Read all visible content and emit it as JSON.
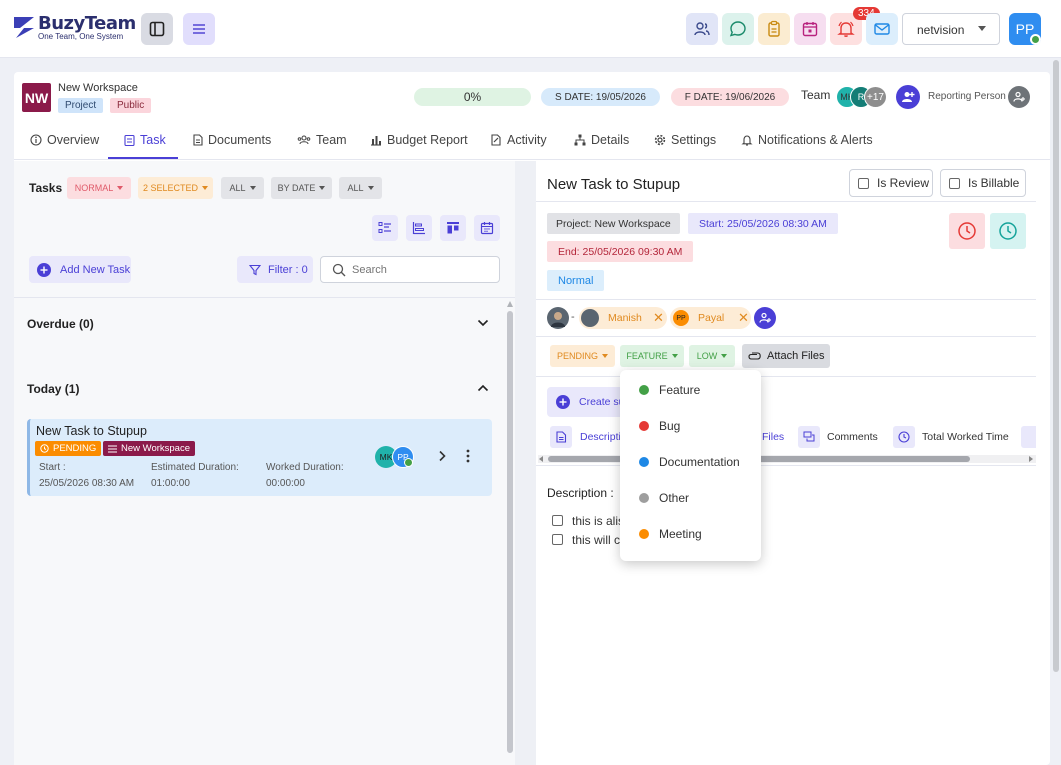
{
  "app": {
    "title": "BuzyTeam",
    "subtitle": "One Team, One System",
    "notifications_count": "334",
    "workspace_select": "netvision",
    "user_initials": "PP"
  },
  "workspace": {
    "initials": "NW",
    "name": "New Workspace",
    "tag_project": "Project",
    "tag_public": "Public",
    "progress": "0%",
    "progress_value": 0,
    "start_date": "S DATE: 19/05/2026",
    "finish_date": "F DATE: 19/06/2026",
    "team_label": "Team",
    "team_avatars": [
      "MK",
      "R",
      "+17"
    ],
    "reporting_label": "Reporting Person"
  },
  "tabs": [
    "Overview",
    "Task",
    "Documents",
    "Team",
    "Budget Report",
    "Activity",
    "Details",
    "Settings",
    "Notifications & Alerts"
  ],
  "task_list": {
    "heading": "Tasks",
    "filters": [
      "NORMAL",
      "2 SELECTED",
      "ALL",
      "BY DATE",
      "ALL"
    ],
    "add_label": "Add New Task",
    "filter_label": "Filter : 0",
    "search_placeholder": "Search",
    "groups": [
      {
        "title": "Overdue (0)"
      },
      {
        "title": "Today (1)"
      }
    ],
    "card": {
      "title": "New Task to Stupup",
      "status": "PENDING",
      "workspace": "New Workspace",
      "start_label": "Start :",
      "start_value": "25/05/2026 08:30 AM",
      "est_label": "Estimated Duration:",
      "est_value": "01:00:00",
      "worked_label": "Worked Duration:",
      "worked_value": "00:00:00",
      "avatars": [
        "MK",
        "PP"
      ]
    }
  },
  "detail": {
    "title": "New Task to Stupup",
    "is_review": "Is Review",
    "is_billable": "Is Billable",
    "project": "Project: New Workspace",
    "start": "Start: 25/05/2026 08:30 AM",
    "end": "End: 25/05/2026 09:30 AM",
    "priority": "Normal",
    "assignees": [
      "Manish",
      "Payal"
    ],
    "status_chip": "PENDING",
    "type_chip": "FEATURE",
    "level_chip": "LOW",
    "attach_label": "Attach Files",
    "create_sub_label": "Create su",
    "subtabs": [
      "Descripti",
      "Files",
      "Comments",
      "Total Worked Time"
    ],
    "description_label": "Description :",
    "checklist": [
      "this is alis",
      "this will c"
    ]
  },
  "type_menu": {
    "items": [
      {
        "label": "Feature",
        "color": "#43a047"
      },
      {
        "label": "Bug",
        "color": "#e53935"
      },
      {
        "label": "Documentation",
        "color": "#1e88e5"
      },
      {
        "label": "Other",
        "color": "#9e9e9e"
      },
      {
        "label": "Meeting",
        "color": "#fb8c00"
      }
    ]
  }
}
